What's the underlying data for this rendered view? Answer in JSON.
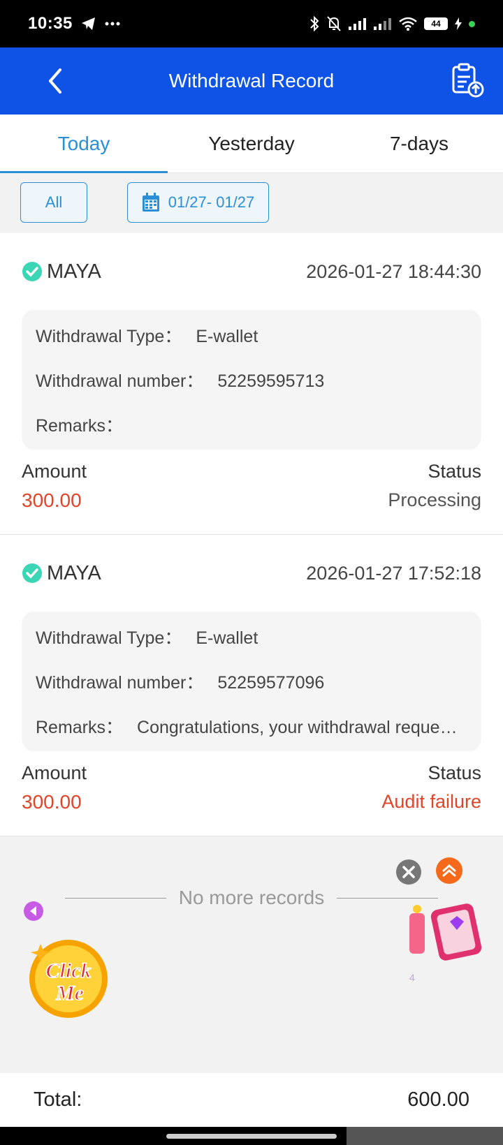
{
  "status_bar": {
    "time": "10:35",
    "battery": "44"
  },
  "header": {
    "title": "Withdrawal Record"
  },
  "tabs": [
    {
      "label": "Today",
      "active": true
    },
    {
      "label": "Yesterday",
      "active": false
    },
    {
      "label": "7-days",
      "active": false
    }
  ],
  "filters": {
    "all_label": "All",
    "date_range": "01/27- 01/27"
  },
  "records": [
    {
      "provider": "MAYA",
      "datetime": "2026-01-27 18:44:30",
      "type_label": "Withdrawal Type：",
      "type_value": "E-wallet",
      "number_label": "Withdrawal number：",
      "number_value": "52259595713",
      "remarks_label": "Remarks：",
      "remarks_value": "",
      "amount_label": "Amount",
      "amount_value": "300.00",
      "status_label": "Status",
      "status_value": "Processing"
    },
    {
      "provider": "MAYA",
      "datetime": "2026-01-27 17:52:18",
      "type_label": "Withdrawal Type：",
      "type_value": "E-wallet",
      "number_label": "Withdrawal number：",
      "number_value": "52259577096",
      "remarks_label": "Remarks：",
      "remarks_value": "Congratulations, your withdrawal reque…",
      "amount_label": "Amount",
      "amount_value": "300.00",
      "status_label": "Status",
      "status_value": "Audit failure"
    }
  ],
  "no_more_text": "No more records",
  "promo": {
    "click_me_line1": "Click",
    "click_me_line2": "Me",
    "badge_number": "4"
  },
  "footer": {
    "total_label": "Total:",
    "total_value": "600.00"
  },
  "colors": {
    "header_bg": "#0f52e6",
    "accent": "#2b8fd6",
    "amount_red": "#e0452a"
  }
}
